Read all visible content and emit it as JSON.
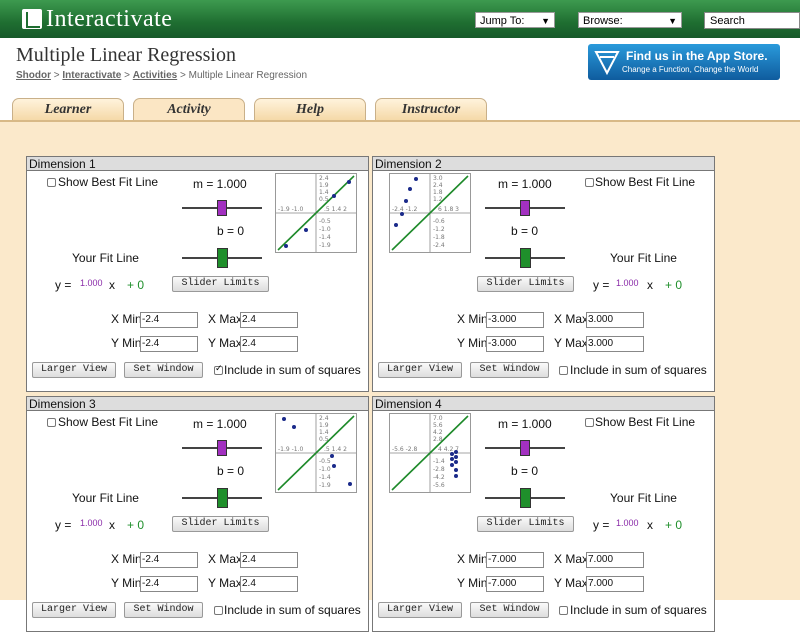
{
  "header": {
    "logo_text": "Interactivate",
    "jump_to": "Jump To:",
    "browse": "Browse:",
    "search_placeholder": "Search"
  },
  "page": {
    "title": "Multiple Linear Regression",
    "breadcrumb": [
      "Shodor",
      "Interactivate",
      "Activities",
      "Multiple Linear Regression"
    ],
    "app_store_line1": "Find us in the App Store.",
    "app_store_line2": "Change a Function, Change the World"
  },
  "tabs": [
    {
      "label": "Learner",
      "active": false
    },
    {
      "label": "Activity",
      "active": true
    },
    {
      "label": "Help",
      "active": false
    },
    {
      "label": "Instructor",
      "active": false
    }
  ],
  "common": {
    "show_best_fit": "Show Best Fit Line",
    "your_fit_line": "Your Fit Line",
    "slider_limits": "Slider Limits",
    "larger_view": "Larger View",
    "set_window": "Set Window",
    "include_sum": "Include in sum of squares",
    "y_eq": "y =",
    "x": "x",
    "b_const": "+ 0",
    "xmin_label": "X Min",
    "xmax_label": "X Max",
    "ymin_label": "Y Min",
    "ymax_label": "Y Max"
  },
  "dimensions": [
    {
      "title": "Dimension 1",
      "m": "m = 1.000",
      "b": "b = 0",
      "slope": "1.000",
      "xmin": "-2.4",
      "xmax": "2.4",
      "ymin": "-2.4",
      "ymax": "2.4",
      "include": true,
      "graph": {
        "xticks_left": "-1.9 -1.0",
        "xticks_right": ".5 1.4 2",
        "yticks_top": [
          "2.4",
          "1.9",
          "1.4",
          "0.5"
        ],
        "yticks_bottom": [
          "-0.5",
          "-1.0",
          "-1.4",
          "-1.9"
        ]
      }
    },
    {
      "title": "Dimension 2",
      "m": "m = 1.000",
      "b": "b = 0",
      "slope": "1.000",
      "xmin": "-3.000",
      "xmax": "3.000",
      "ymin": "-3.000",
      "ymax": "3.000",
      "include": false,
      "graph": {
        "xticks_left": "-2.4 -1.2",
        "xticks_right": "6 1.8 3",
        "yticks_top": [
          "3.0",
          "2.4",
          "1.8",
          "1.2"
        ],
        "yticks_bottom": [
          "-0.6",
          "-1.2",
          "-1.8",
          "-2.4"
        ]
      }
    },
    {
      "title": "Dimension 3",
      "m": "m = 1.000",
      "b": "b = 0",
      "slope": "1.000",
      "xmin": "-2.4",
      "xmax": "2.4",
      "ymin": "-2.4",
      "ymax": "2.4",
      "include": false,
      "graph": {
        "xticks_left": "-1.9 -1.0",
        "xticks_right": ".5 1.4 2",
        "yticks_top": [
          "2.4",
          "1.9",
          "1.4",
          "0.5"
        ],
        "yticks_bottom": [
          "-0.5",
          "-1.0",
          "-1.4",
          "-1.9"
        ]
      }
    },
    {
      "title": "Dimension 4",
      "m": "m = 1.000",
      "b": "b = 0",
      "slope": "1.000",
      "xmin": "-7.000",
      "xmax": "7.000",
      "ymin": "-7.000",
      "ymax": "7.000",
      "include": false,
      "graph": {
        "xticks_left": "-5.6 -2.8",
        "xticks_right": "4 4.2 7",
        "yticks_top": [
          "7.0",
          "5.6",
          "4.2",
          "2.8"
        ],
        "yticks_bottom": [
          "-1.4",
          "-2.8",
          "-4.2",
          "-5.6"
        ]
      }
    }
  ]
}
